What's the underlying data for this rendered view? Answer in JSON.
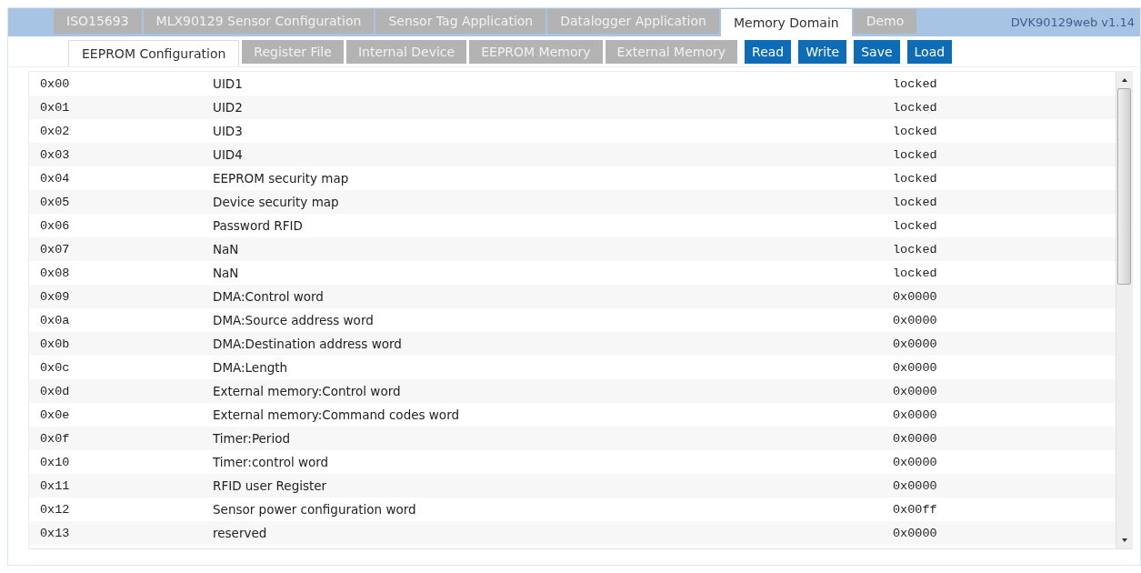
{
  "app_title": "DVK90129web v1.14",
  "tabs": [
    {
      "label": "ISO15693",
      "selected": false
    },
    {
      "label": "MLX90129 Sensor Configuration",
      "selected": false
    },
    {
      "label": "Sensor Tag Application",
      "selected": false
    },
    {
      "label": "Datalogger Application",
      "selected": false
    },
    {
      "label": "Memory Domain",
      "selected": true
    },
    {
      "label": "Demo",
      "selected": false
    }
  ],
  "subtabs": [
    {
      "kind": "tab",
      "label": "EEPROM Configuration",
      "selected": true
    },
    {
      "kind": "tab",
      "label": "Register File",
      "selected": false
    },
    {
      "kind": "tab",
      "label": "Internal Device",
      "selected": false
    },
    {
      "kind": "tab",
      "label": "EEPROM Memory",
      "selected": false
    },
    {
      "kind": "tab",
      "label": "External Memory",
      "selected": false
    },
    {
      "kind": "button",
      "label": "Read"
    },
    {
      "kind": "button",
      "label": "Write"
    },
    {
      "kind": "button",
      "label": "Save"
    },
    {
      "kind": "button",
      "label": "Load"
    }
  ],
  "rows": [
    {
      "address": "0x00",
      "name": "UID1",
      "value": "locked"
    },
    {
      "address": "0x01",
      "name": "UID2",
      "value": "locked"
    },
    {
      "address": "0x02",
      "name": "UID3",
      "value": "locked"
    },
    {
      "address": "0x03",
      "name": "UID4",
      "value": "locked"
    },
    {
      "address": "0x04",
      "name": "EEPROM security map",
      "value": "locked"
    },
    {
      "address": "0x05",
      "name": "Device security map",
      "value": "locked"
    },
    {
      "address": "0x06",
      "name": "Password RFID",
      "value": "locked"
    },
    {
      "address": "0x07",
      "name": "NaN",
      "value": "locked"
    },
    {
      "address": "0x08",
      "name": "NaN",
      "value": "locked"
    },
    {
      "address": "0x09",
      "name": "DMA:Control word",
      "value": "0x0000"
    },
    {
      "address": "0x0a",
      "name": "DMA:Source address word",
      "value": "0x0000"
    },
    {
      "address": "0x0b",
      "name": "DMA:Destination address word",
      "value": "0x0000"
    },
    {
      "address": "0x0c",
      "name": "DMA:Length",
      "value": "0x0000"
    },
    {
      "address": "0x0d",
      "name": "External memory:Control word",
      "value": "0x0000"
    },
    {
      "address": "0x0e",
      "name": "External memory:Command codes word",
      "value": "0x0000"
    },
    {
      "address": "0x0f",
      "name": "Timer:Period",
      "value": "0x0000"
    },
    {
      "address": "0x10",
      "name": "Timer:control word",
      "value": "0x0000"
    },
    {
      "address": "0x11",
      "name": "RFID user Register",
      "value": "0x0000"
    },
    {
      "address": "0x12",
      "name": "Sensor power configuration word",
      "value": "0x00ff"
    },
    {
      "address": "0x13",
      "name": "reserved",
      "value": "0x0000"
    }
  ]
}
